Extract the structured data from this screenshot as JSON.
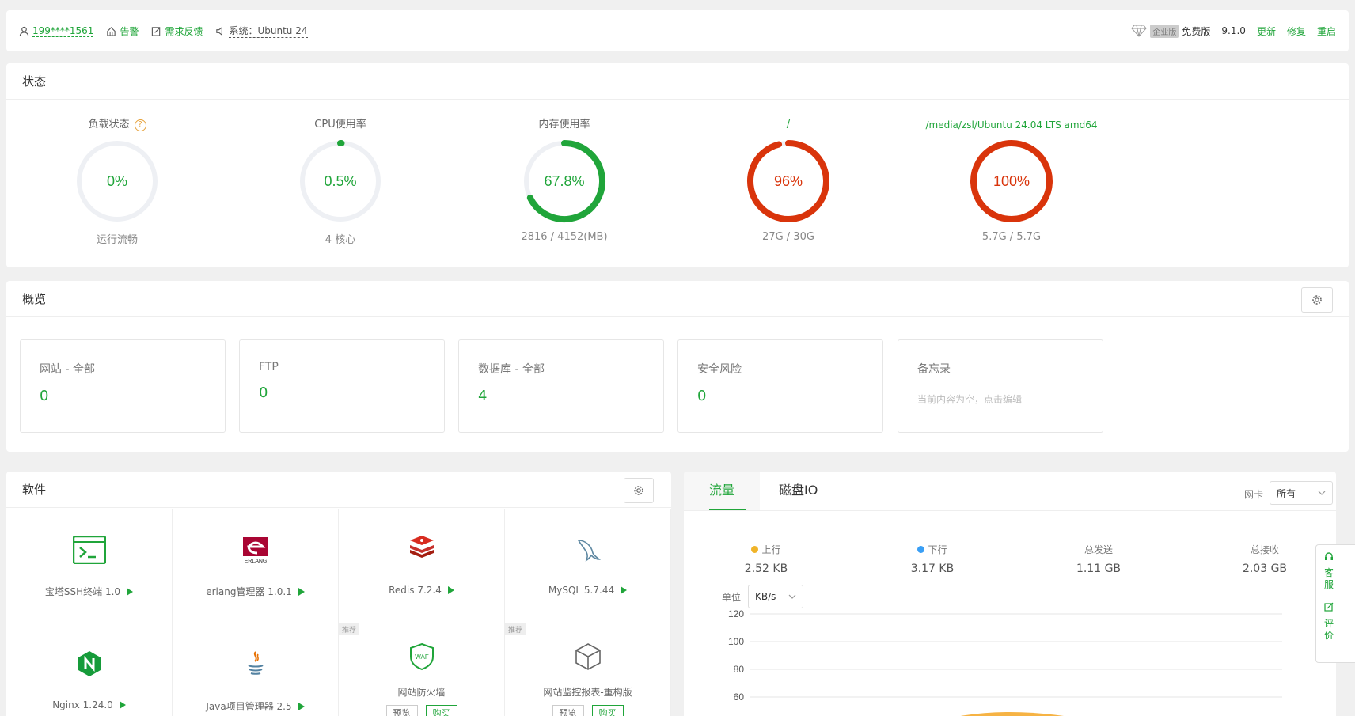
{
  "topbar": {
    "phone": "199****1561",
    "alert": "告警",
    "feedback": "需求反馈",
    "system": "系统：Ubuntu 24",
    "enterprise_badge": "企业版",
    "edition": "免费版",
    "version": "9.1.0",
    "update": "更新",
    "repair": "修复",
    "restart": "重启"
  },
  "status": {
    "title": "状态",
    "gauges": [
      {
        "label": "负载状态",
        "value": "0%",
        "percent": 0,
        "sub": "运行流畅",
        "color": "#20a53a",
        "label_color": "#666"
      },
      {
        "label": "CPU使用率",
        "value": "0.5%",
        "percent": 0.5,
        "sub": "4 核心",
        "color": "#20a53a",
        "label_color": "#666"
      },
      {
        "label": "内存使用率",
        "value": "67.8%",
        "percent": 67.8,
        "sub": "2816 / 4152(MB)",
        "color": "#20a53a",
        "label_color": "#666"
      },
      {
        "label": "/",
        "value": "96%",
        "percent": 96,
        "sub": "27G / 30G",
        "color": "#d9340b",
        "label_color": "#20a53a"
      },
      {
        "label": "/media/zsl/Ubuntu 24.04 LTS amd64",
        "value": "100%",
        "percent": 100,
        "sub": "5.7G / 5.7G",
        "color": "#d9340b",
        "label_color": "#20a53a"
      }
    ]
  },
  "overview": {
    "title": "概览",
    "cards": [
      {
        "title": "网站 - 全部",
        "value": "0"
      },
      {
        "title": "FTP",
        "value": "0"
      },
      {
        "title": "数据库 - 全部",
        "value": "4"
      },
      {
        "title": "安全风险",
        "value": "0"
      },
      {
        "title": "备忘录",
        "note": "当前内容为空，点击编辑"
      }
    ]
  },
  "software": {
    "title": "软件",
    "recommend": "推荐",
    "preview": "预览",
    "buy": "购买",
    "items": [
      {
        "name": "宝塔SSH终端 1.0",
        "icon": "terminal-icon"
      },
      {
        "name": "erlang管理器 1.0.1",
        "icon": "erlang-icon"
      },
      {
        "name": "Redis 7.2.4",
        "icon": "redis-icon"
      },
      {
        "name": "MySQL 5.7.44",
        "icon": "mysql-icon"
      },
      {
        "name": "Nginx 1.24.0",
        "icon": "nginx-icon"
      },
      {
        "name": "Java项目管理器 2.5",
        "icon": "java-icon"
      },
      {
        "name": "网站防火墙",
        "icon": "waf-icon"
      },
      {
        "name": "网站监控报表-重构版",
        "icon": "monitor-box-icon"
      }
    ]
  },
  "traffic": {
    "tabs": [
      "流量",
      "磁盘IO"
    ],
    "nic_label": "网卡",
    "nic_value": "所有",
    "stats": [
      {
        "label": "上行",
        "value": "2.52 KB",
        "dot": "#f0b429"
      },
      {
        "label": "下行",
        "value": "3.17 KB",
        "dot": "#3a9ff5"
      },
      {
        "label": "总发送",
        "value": "1.11 GB"
      },
      {
        "label": "总接收",
        "value": "2.03 GB"
      }
    ],
    "unit_label": "单位",
    "unit_value": "KB/s",
    "y_ticks": [
      "120",
      "100",
      "80",
      "60"
    ]
  },
  "side": {
    "service": "客服",
    "review": "评价"
  }
}
